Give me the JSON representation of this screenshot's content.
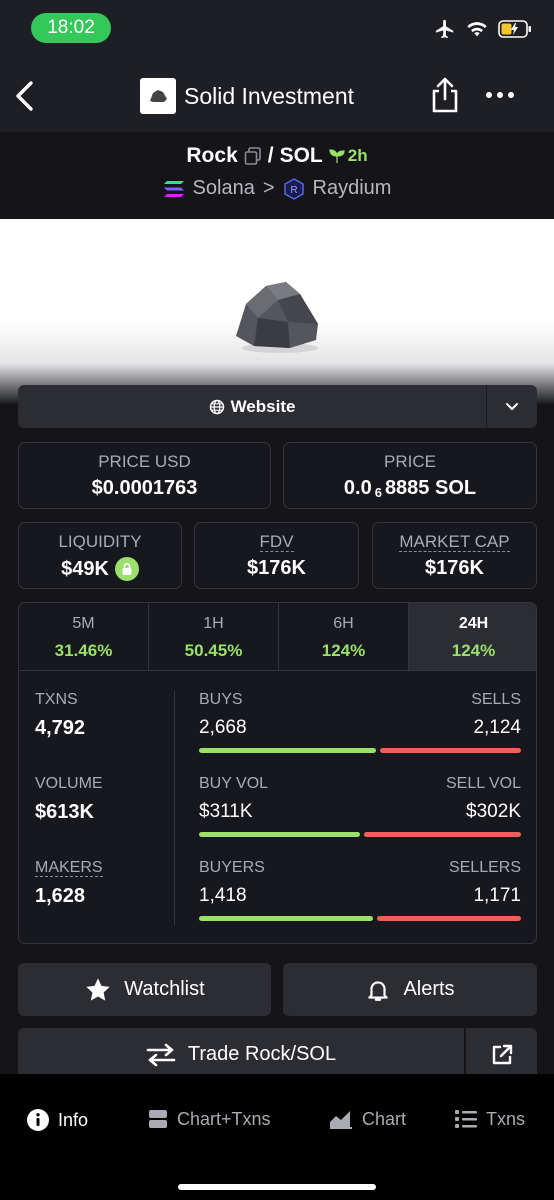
{
  "status": {
    "time": "18:02"
  },
  "nav": {
    "title": "Solid Investment"
  },
  "pair": {
    "base": "Rock",
    "separator": "/",
    "quote": "SOL",
    "age": "2h",
    "chain": "Solana",
    "chevron": ">",
    "dex": "Raydium"
  },
  "website": {
    "label": "Website"
  },
  "price_usd": {
    "label": "PRICE USD",
    "value": "$0.0001763"
  },
  "price": {
    "label": "PRICE",
    "prefix": "0.0",
    "subscript": "6",
    "suffix": "8885 SOL"
  },
  "liquidity": {
    "label": "LIQUIDITY",
    "value": "$49K"
  },
  "fdv": {
    "label": "FDV",
    "value": "$176K"
  },
  "market_cap": {
    "label": "MARKET CAP",
    "value": "$176K"
  },
  "timeframes": [
    {
      "label": "5M",
      "change": "31.46%"
    },
    {
      "label": "1H",
      "change": "50.45%"
    },
    {
      "label": "6H",
      "change": "124%"
    },
    {
      "label": "24H",
      "change": "124%"
    }
  ],
  "stats": {
    "txns": {
      "label": "TXNS",
      "value": "4,792"
    },
    "volume": {
      "label": "VOLUME",
      "value": "$613K"
    },
    "makers": {
      "label": "MAKERS",
      "value": "1,628"
    },
    "buys": {
      "label": "BUYS",
      "value": "2,668",
      "sell_label": "SELLS",
      "sell_value": "2,124",
      "buy_fraction": 0.557
    },
    "vol": {
      "label": "BUY VOL",
      "value": "$311K",
      "sell_label": "SELL VOL",
      "sell_value": "$302K",
      "buy_fraction": 0.507
    },
    "buyers": {
      "label": "BUYERS",
      "value": "1,418",
      "sell_label": "SELLERS",
      "sell_value": "1,171",
      "buy_fraction": 0.548
    }
  },
  "actions": {
    "watchlist": "Watchlist",
    "alerts": "Alerts",
    "trade": "Trade Rock/SOL"
  },
  "bottom_nav": [
    {
      "label": "Info",
      "icon": "info-icon"
    },
    {
      "label": "Chart+Txns",
      "icon": "split-icon"
    },
    {
      "label": "Chart",
      "icon": "area-chart-icon"
    },
    {
      "label": "Txns",
      "icon": "list-icon"
    }
  ],
  "colors": {
    "green": "#9ae06a",
    "red": "#e8625c",
    "background": "#141419",
    "card": "#2c2d33"
  }
}
